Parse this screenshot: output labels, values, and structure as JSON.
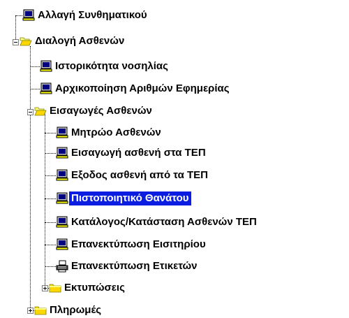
{
  "tree": {
    "items": [
      {
        "label": "Αλλαγή Συνθηματικού",
        "icon": "monitor-icon"
      },
      {
        "label": "Διαλογή Ασθενών",
        "icon": "folder-open-icon",
        "expanded": true
      },
      {
        "label": "Ιστορικότητα νοσηλίας",
        "icon": "monitor-icon"
      },
      {
        "label": "Αρχικοποίηση Αριθμών Εφημερίας",
        "icon": "monitor-icon"
      },
      {
        "label": "Εισαγωγές Ασθενών",
        "icon": "folder-open-icon",
        "expanded": true
      },
      {
        "label": "Μητρώο Ασθενών",
        "icon": "monitor-icon"
      },
      {
        "label": "Εισαγωγή ασθενή στα ΤΕΠ",
        "icon": "monitor-icon"
      },
      {
        "label": "Εξοδος ασθενή από τα ΤΕΠ",
        "icon": "monitor-icon"
      },
      {
        "label": "Πιστοποιητικό Θανάτου",
        "icon": "monitor-icon",
        "selected": true
      },
      {
        "label": "Κατάλογος/Κατάσταση Ασθενών ΤΕΠ",
        "icon": "monitor-icon"
      },
      {
        "label": "Επανεκτύπωση Εισιτηρίου",
        "icon": "monitor-icon"
      },
      {
        "label": "Επανεκτύπωση Ετικετών",
        "icon": "printer-icon"
      },
      {
        "label": "Εκτυπώσεις",
        "icon": "folder-closed-icon",
        "expanded": false
      },
      {
        "label": "Πληρωμές",
        "icon": "folder-closed-icon",
        "expanded": false
      }
    ]
  },
  "colors": {
    "selection_background": "#0a1de0",
    "selection_text": "#ffffff",
    "connector": "#000000"
  }
}
